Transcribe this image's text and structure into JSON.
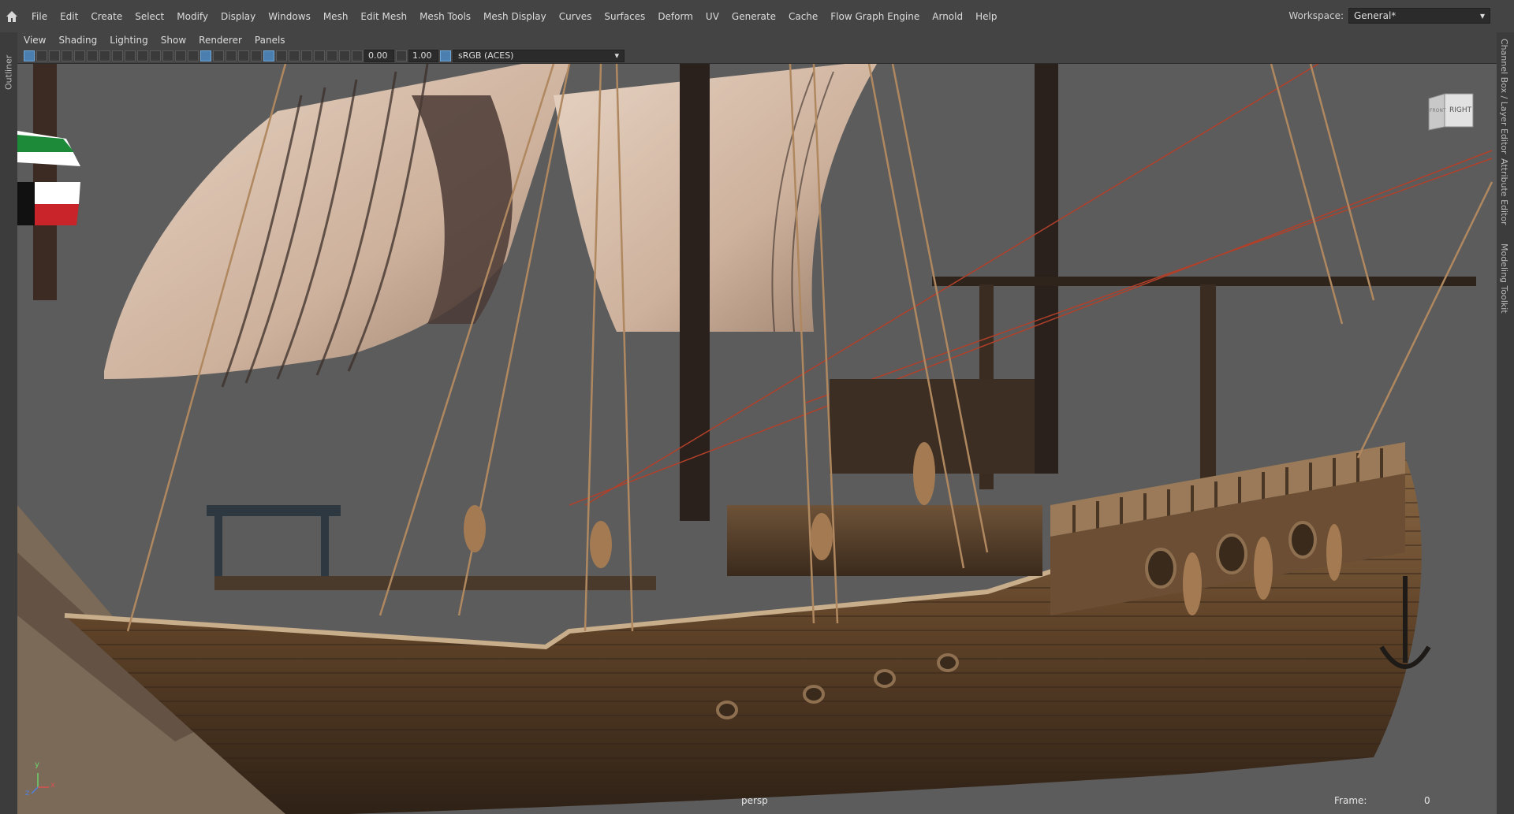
{
  "menubar": {
    "items": [
      "File",
      "Edit",
      "Create",
      "Select",
      "Modify",
      "Display",
      "Windows",
      "Mesh",
      "Edit Mesh",
      "Mesh Tools",
      "Mesh Display",
      "Curves",
      "Surfaces",
      "Deform",
      "UV",
      "Generate",
      "Cache",
      "Flow Graph Engine",
      "Arnold",
      "Help"
    ],
    "workspace_label": "Workspace:",
    "workspace_value": "General*"
  },
  "side_tabs": {
    "left": "Outliner",
    "right": [
      "Channel Box / Layer Editor",
      "Attribute Editor",
      "Modeling Toolkit"
    ]
  },
  "panel_menu": [
    "View",
    "Shading",
    "Lighting",
    "Show",
    "Renderer",
    "Panels"
  ],
  "toolbar": {
    "exposure": "0.00",
    "gamma": "1.00",
    "color_space": "sRGB (ACES)"
  },
  "viewport": {
    "camera": "persp",
    "frame_label": "Frame:",
    "frame_value": "0",
    "viewcube_front": "FRONT",
    "viewcube_right": "RIGHT",
    "axis_y": "y",
    "axis_x": "x",
    "axis_z": "z"
  },
  "colors": {
    "ui_bg": "#444444",
    "viewport_bg": "#5c5c5c",
    "accent": "#4a7fb0"
  }
}
